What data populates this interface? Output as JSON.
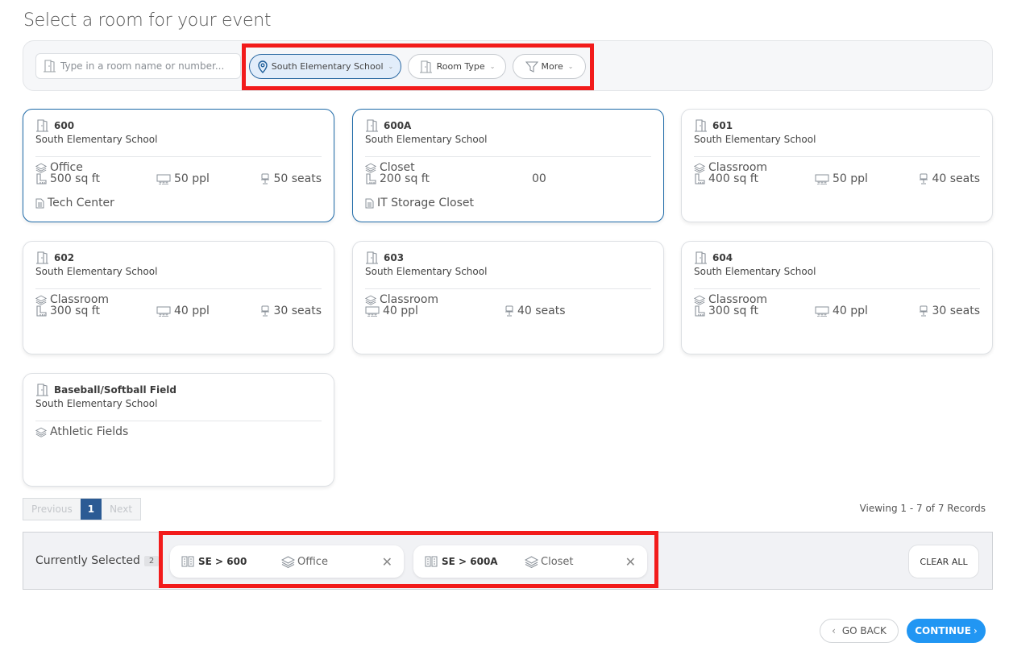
{
  "page": {
    "title": "Select a room for your event"
  },
  "filters": {
    "search_placeholder": "Type in a room name or number...",
    "search_value": "",
    "location": {
      "label": "South Elementary School",
      "icon": "map-pin-icon",
      "active": true
    },
    "room_type": {
      "label": "Room Type",
      "icon": "door-icon"
    },
    "more": {
      "label": "More",
      "icon": "filter-icon"
    }
  },
  "rooms": [
    {
      "name": "600",
      "building": "South Elementary School",
      "type": "Office",
      "sqft": "500 sq ft",
      "people": "50 ppl",
      "seats": "50 seats",
      "note": "Tech Center",
      "selected": true
    },
    {
      "name": "600A",
      "building": "South Elementary School",
      "type": "Closet",
      "sqft": "200 sq ft",
      "people": "00",
      "seats": "",
      "note": "IT Storage Closet",
      "selected": true
    },
    {
      "name": "601",
      "building": "South Elementary School",
      "type": "Classroom",
      "sqft": "400 sq ft",
      "people": "50 ppl",
      "seats": "40 seats",
      "note": "",
      "selected": false
    },
    {
      "name": "602",
      "building": "South Elementary School",
      "type": "Classroom",
      "sqft": "300 sq ft",
      "people": "40 ppl",
      "seats": "30 seats",
      "note": "",
      "selected": false
    },
    {
      "name": "603",
      "building": "South Elementary School",
      "type": "Classroom",
      "sqft": "",
      "people": "40 ppl",
      "seats": "40 seats",
      "note": "",
      "selected": false
    },
    {
      "name": "604",
      "building": "South Elementary School",
      "type": "Classroom",
      "sqft": "300 sq ft",
      "people": "40 ppl",
      "seats": "30 seats",
      "note": "",
      "selected": false
    },
    {
      "name": "Baseball/Softball Field",
      "building": "South Elementary School",
      "type": "Athletic Fields",
      "sqft": "",
      "people": "",
      "seats": "",
      "note": "",
      "selected": false
    }
  ],
  "pagination": {
    "previous": "Previous",
    "current": "1",
    "next": "Next",
    "records": "Viewing 1 - 7 of 7 Records"
  },
  "selection": {
    "label": "Currently Selected",
    "count": "2",
    "items": [
      {
        "room": "SE > 600",
        "type": "Office"
      },
      {
        "room": "SE > 600A",
        "type": "Closet"
      }
    ],
    "clear_all": "CLEAR ALL"
  },
  "footer": {
    "go_back": "GO BACK",
    "continue": "CONTINUE"
  },
  "colors": {
    "accent": "#2196f3",
    "selected_border": "#1e6aa8",
    "page_active": "#2c5b94",
    "highlight": "#f21b1b"
  }
}
